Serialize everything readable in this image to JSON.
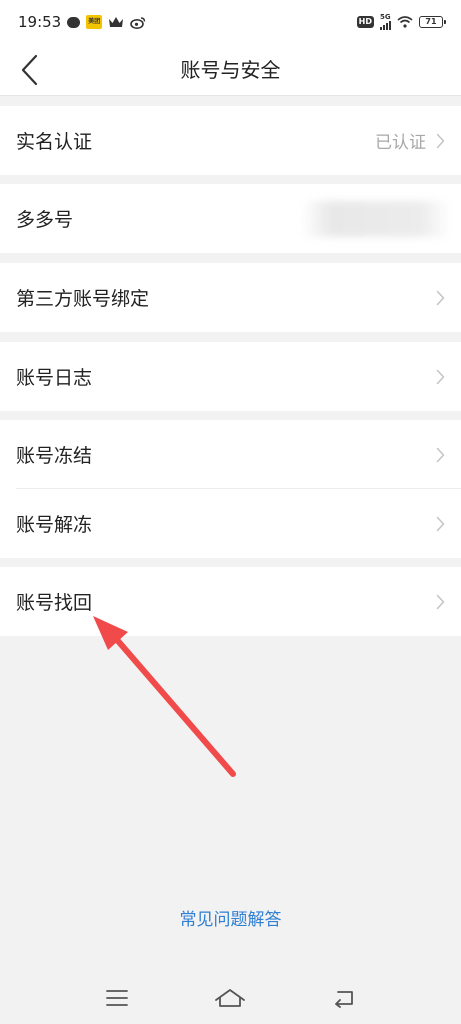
{
  "status_bar": {
    "time": "19:53",
    "app_badge": "美团",
    "hd_badge": "HD",
    "network": "5G",
    "battery": "71",
    "icons": [
      "chat-bubble-icon",
      "meituan-icon",
      "crown-icon",
      "weibo-icon",
      "hd-icon",
      "signal-icon",
      "wifi-icon",
      "battery-icon"
    ]
  },
  "header": {
    "title": "账号与安全",
    "back_icon": "chevron-left-icon"
  },
  "rows": {
    "real_name": {
      "label": "实名认证",
      "value": "已认证"
    },
    "duoduo_id": {
      "label": "多多号"
    },
    "third_party": {
      "label": "第三方账号绑定"
    },
    "account_log": {
      "label": "账号日志"
    },
    "freeze": {
      "label": "账号冻结"
    },
    "unfreeze": {
      "label": "账号解冻"
    },
    "recover": {
      "label": "账号找回"
    }
  },
  "footer": {
    "faq_link": "常见问题解答"
  },
  "system_nav": {
    "icons": [
      "menu-icon",
      "home-icon",
      "back-icon"
    ]
  },
  "colors": {
    "page_background": "#f2f2f2",
    "card_background": "#ffffff",
    "link": "#2f7fd2",
    "annotation_arrow": "#f04a4a",
    "secondary_text": "#a8a8a8"
  }
}
